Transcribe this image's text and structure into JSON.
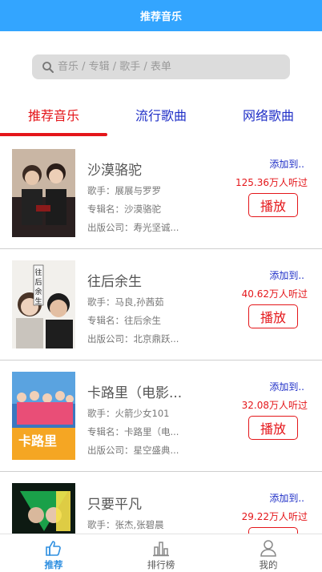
{
  "header": {
    "title": "推荐音乐"
  },
  "search": {
    "placeholder": "音乐 / 专辑 / 歌手 / 表单",
    "icon": "search-icon"
  },
  "tabs": [
    {
      "label": "推荐音乐",
      "active": true
    },
    {
      "label": "流行歌曲",
      "active": false
    },
    {
      "label": "网络歌曲",
      "active": false
    }
  ],
  "songs": [
    {
      "title": "沙漠骆驼",
      "singer": "歌手：展展与罗罗",
      "album": "专辑名：沙漠骆驼",
      "publisher": "出版公司：寿光坚诚...",
      "add": "添加到..",
      "plays": "125.36万人听过",
      "play": "播放"
    },
    {
      "title": "往后余生",
      "singer": "歌手：马良,孙茜茹",
      "album": "专辑名：往后余生",
      "publisher": "出版公司：北京鼎跃...",
      "add": "添加到..",
      "plays": "40.62万人听过",
      "play": "播放"
    },
    {
      "title": "卡路里（电影...",
      "singer": "歌手：火箭少女101",
      "album": "专辑名：卡路里（电...",
      "publisher": "出版公司：星空盛典...",
      "add": "添加到..",
      "plays": "32.08万人听过",
      "play": "播放"
    },
    {
      "title": "只要平凡",
      "singer": "歌手：张杰,张碧晨",
      "album": "",
      "publisher": "",
      "add": "添加到..",
      "plays": "29.22万人听过",
      "play": "播放"
    }
  ],
  "bottom_nav": [
    {
      "label": "推荐",
      "icon": "thumbs-up-icon",
      "active": true
    },
    {
      "label": "排行榜",
      "icon": "chart-icon",
      "active": false
    },
    {
      "label": "我的",
      "icon": "user-icon",
      "active": false
    }
  ],
  "colors": {
    "header": "#33a5ff",
    "accent_red": "#e4161a",
    "link_blue": "#1f2fc7",
    "nav_active": "#2f8fe0"
  }
}
